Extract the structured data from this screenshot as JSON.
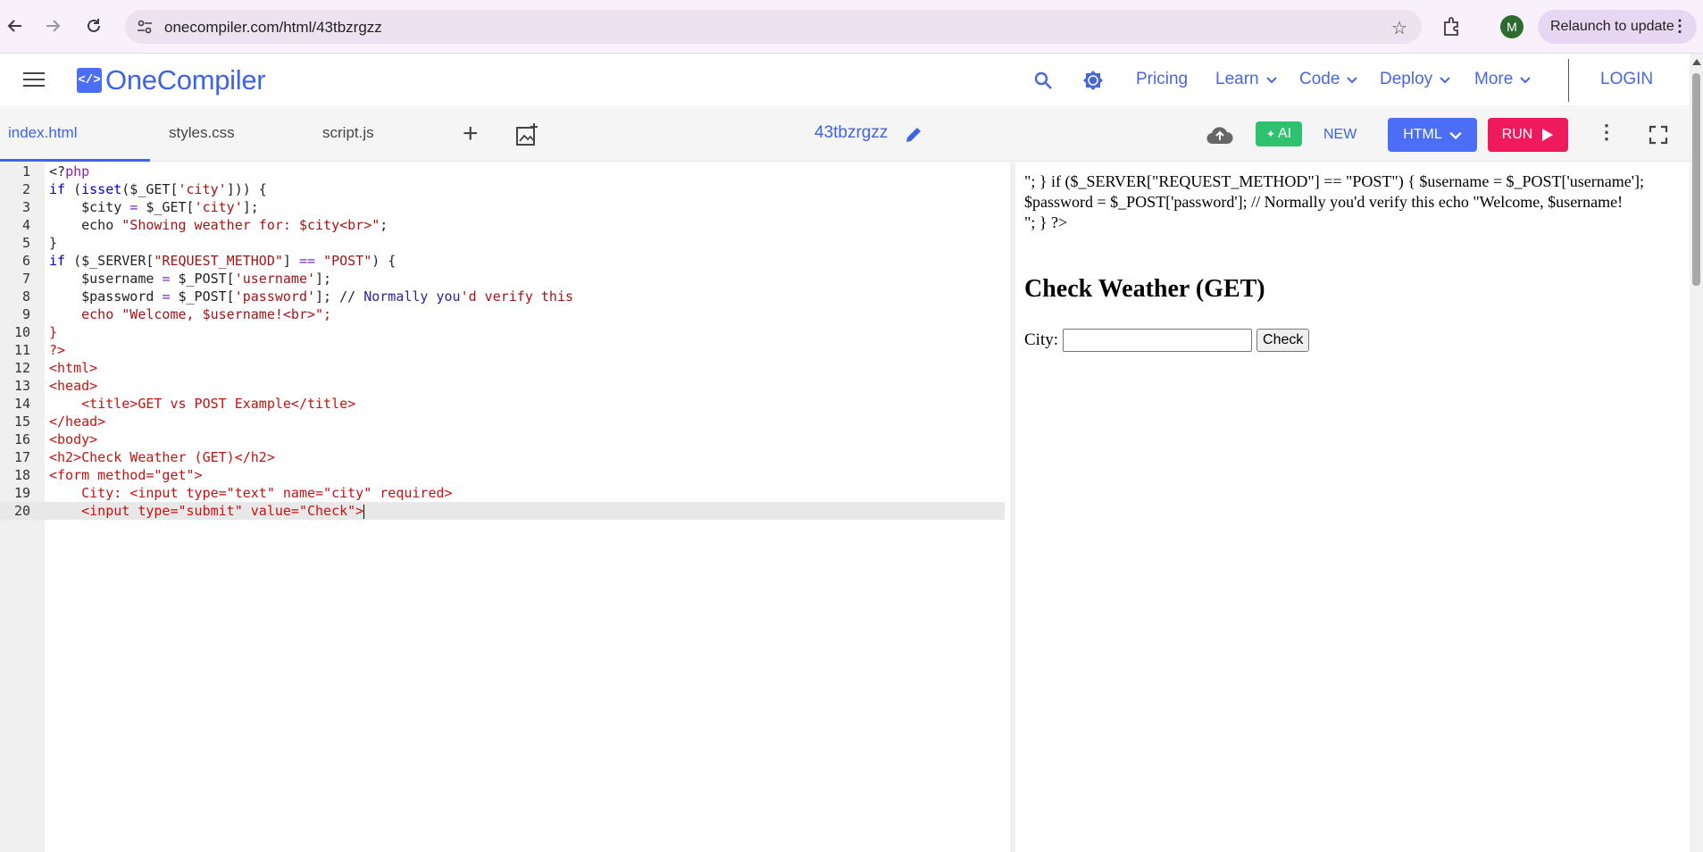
{
  "browser": {
    "url": "onecompiler.com/html/43tbzrgzz",
    "profile_initial": "M",
    "relaunch_label": "Relaunch to update",
    "icons": [
      "back-arrow-icon",
      "forward-arrow-icon",
      "reload-icon",
      "site-settings-icon",
      "star-icon",
      "extensions-icon",
      "more-icon"
    ]
  },
  "header": {
    "logo_symbol": "</>",
    "logo_text": "OneCompiler",
    "nav": [
      "Pricing",
      "Learn",
      "Code",
      "Deploy",
      "More"
    ],
    "login": "LOGIN"
  },
  "toolbar": {
    "tabs": [
      "index.html",
      "styles.css",
      "script.js"
    ],
    "active_tab": "index.html",
    "project_name": "43tbzrgzz",
    "ai_label": "AI",
    "new_label": "NEW",
    "language_label": "HTML",
    "run_label": "RUN"
  },
  "editor": {
    "current_line": 20,
    "lines": [
      {
        "n": "1",
        "parts": [
          [
            "plain",
            "<?"
          ],
          [
            "ph",
            "php"
          ]
        ]
      },
      {
        "n": "2",
        "parts": [
          [
            "kw",
            "if"
          ],
          [
            "plain",
            " ("
          ],
          [
            "kw",
            "isset"
          ],
          [
            "plain",
            "($_GET["
          ],
          [
            "str",
            "'city'"
          ],
          [
            "plain",
            "])) {"
          ]
        ]
      },
      {
        "n": "3",
        "parts": [
          [
            "plain",
            "    $city "
          ],
          [
            "op",
            "="
          ],
          [
            "plain",
            " $_GET["
          ],
          [
            "str",
            "'city'"
          ],
          [
            "plain",
            "];"
          ]
        ]
      },
      {
        "n": "4",
        "parts": [
          [
            "plain",
            "    echo "
          ],
          [
            "str",
            "\"Showing weather for: $city<br>\""
          ],
          [
            "plain",
            ";"
          ]
        ]
      },
      {
        "n": "5",
        "parts": [
          [
            "plain",
            "}"
          ]
        ]
      },
      {
        "n": "6",
        "parts": [
          [
            "kw",
            "if"
          ],
          [
            "plain",
            " ($_SERVER["
          ],
          [
            "str",
            "\"REQUEST_METHOD\""
          ],
          [
            "plain",
            "] "
          ],
          [
            "op",
            "=="
          ],
          [
            "plain",
            " "
          ],
          [
            "str",
            "\"POST\""
          ],
          [
            "plain",
            ") {"
          ]
        ]
      },
      {
        "n": "7",
        "parts": [
          [
            "plain",
            "    $username "
          ],
          [
            "op",
            "="
          ],
          [
            "plain",
            " $_POST["
          ],
          [
            "str",
            "'username'"
          ],
          [
            "plain",
            "];"
          ]
        ]
      },
      {
        "n": "8",
        "parts": [
          [
            "plain",
            "    $password "
          ],
          [
            "op",
            "="
          ],
          [
            "plain",
            " $_POST["
          ],
          [
            "str",
            "'password'"
          ],
          [
            "plain",
            "]; // "
          ],
          [
            "cmt",
            "Normally you"
          ],
          [
            "str",
            "'d verify this"
          ]
        ]
      },
      {
        "n": "9",
        "parts": [
          [
            "str",
            "    echo \"Welcome, $username!<br>\";"
          ]
        ]
      },
      {
        "n": "10",
        "parts": [
          [
            "tag",
            "}"
          ]
        ]
      },
      {
        "n": "11",
        "parts": [
          [
            "tag",
            "?>"
          ]
        ]
      },
      {
        "n": "12",
        "parts": [
          [
            "tag",
            "<html>"
          ]
        ]
      },
      {
        "n": "13",
        "parts": [
          [
            "tag",
            "<head>"
          ]
        ]
      },
      {
        "n": "14",
        "parts": [
          [
            "tag",
            "    <title>GET vs POST Example</title>"
          ]
        ]
      },
      {
        "n": "15",
        "parts": [
          [
            "tag",
            "</head>"
          ]
        ]
      },
      {
        "n": "16",
        "parts": [
          [
            "tag",
            "<body>"
          ]
        ]
      },
      {
        "n": "17",
        "parts": [
          [
            "tag",
            "<h2>Check Weather (GET)</h2>"
          ]
        ]
      },
      {
        "n": "18",
        "parts": [
          [
            "tag",
            "<form method=\"get\">"
          ]
        ]
      },
      {
        "n": "19",
        "parts": [
          [
            "tag",
            "    City: <input type=\"text\" name=\"city\" required>"
          ]
        ]
      },
      {
        "n": "20",
        "parts": [
          [
            "tag",
            "    <input type=\"submit\" value=\"Check\">"
          ]
        ]
      }
    ]
  },
  "output": {
    "raw_text_1": "\"; } if ($_SERVER[\"REQUEST_METHOD\"] == \"POST\") { $username = $_POST['username']; $password = $_POST['password']; // Normally you'd verify this echo \"Welcome, $username!",
    "raw_text_2": "\"; } ?>",
    "heading": "Check Weather (GET)",
    "city_label": "City:",
    "city_value": "",
    "submit_label": "Check"
  }
}
